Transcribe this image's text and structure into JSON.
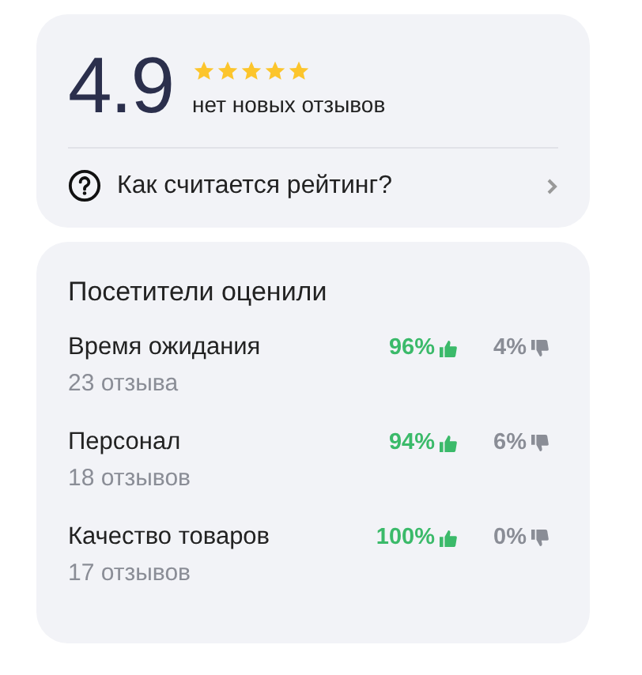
{
  "rating": {
    "value": "4.9",
    "stars": 5,
    "caption": "нет новых отзывов"
  },
  "help_link": {
    "label": "Как считается рейтинг?"
  },
  "aspects": {
    "title": "Посетители оценили",
    "items": [
      {
        "name": "Время ожидания",
        "count": "23 отзыва",
        "positive": "96%",
        "negative": "4%"
      },
      {
        "name": "Персонал",
        "count": "18 отзывов",
        "positive": "94%",
        "negative": "6%"
      },
      {
        "name": "Качество товаров",
        "count": "17 отзывов",
        "positive": "100%",
        "negative": "0%"
      }
    ]
  }
}
